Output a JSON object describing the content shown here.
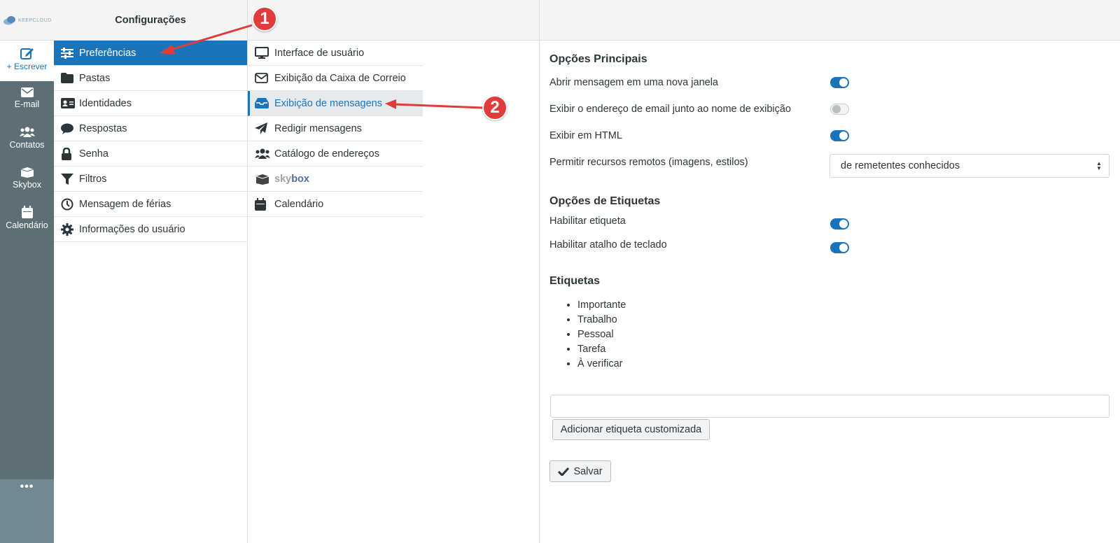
{
  "brand": {
    "logo_text": "KEEPCLOUD"
  },
  "rail": {
    "compose_label": "+ Escrever",
    "items": [
      {
        "label": "E-mail",
        "icon": "envelope-icon"
      },
      {
        "label": "Contatos",
        "icon": "users-icon"
      },
      {
        "label": "Skybox",
        "icon": "box-icon"
      },
      {
        "label": "Calendário",
        "icon": "calendar-icon"
      }
    ],
    "more_label": "•••"
  },
  "menu": {
    "title": "Configurações",
    "items": [
      {
        "label": "Preferências",
        "icon": "sliders-icon",
        "active": true
      },
      {
        "label": "Pastas",
        "icon": "folder-icon"
      },
      {
        "label": "Identidades",
        "icon": "id-card-icon"
      },
      {
        "label": "Respostas",
        "icon": "comment-icon"
      },
      {
        "label": "Senha",
        "icon": "lock-icon"
      },
      {
        "label": "Filtros",
        "icon": "filter-icon"
      },
      {
        "label": "Mensagem de férias",
        "icon": "clock-icon"
      },
      {
        "label": "Informações do usuário",
        "icon": "gear-icon"
      }
    ]
  },
  "sections": {
    "items": [
      {
        "label": "Interface de usuário",
        "icon": "monitor-icon"
      },
      {
        "label": "Exibição da Caixa de Correio",
        "icon": "envelope-outline-icon"
      },
      {
        "label": "Exibição de mensagens",
        "icon": "inbox-icon",
        "active": true
      },
      {
        "label": "Redigir mensagens",
        "icon": "paper-plane-icon"
      },
      {
        "label": "Catálogo de endereços",
        "icon": "users-icon"
      },
      {
        "label_part1": "sky",
        "label_part2": "box",
        "icon": "box-icon"
      },
      {
        "label": "Calendário",
        "icon": "calendar-icon"
      }
    ]
  },
  "content": {
    "main_options_title": "Opções Principais",
    "options": [
      {
        "label": "Abrir mensagem em uma nova janela",
        "enabled": true
      },
      {
        "label": "Exibir o endereço de email junto ao nome de exibição",
        "enabled": false
      },
      {
        "label": "Exibir em HTML",
        "enabled": true
      },
      {
        "label": "Permitir recursos remotos (imagens, estilos)",
        "select_value": "de remetentes conhecidos"
      }
    ],
    "tag_options_title": "Opções de Etiquetas",
    "tag_options": [
      {
        "label": "Habilitar etiqueta",
        "enabled": true
      },
      {
        "label": "Habilitar atalho de teclado",
        "enabled": true
      }
    ],
    "tags_title": "Etiquetas",
    "tags": [
      "Importante",
      "Trabalho",
      "Pessoal",
      "Tarefa",
      "À verificar"
    ],
    "tag_input_value": "",
    "add_tag_button": "Adicionar etiqueta customizada",
    "save_button": "Salvar"
  },
  "annotations": {
    "marker1": "1",
    "marker2": "2"
  },
  "colors": {
    "accent": "#1b74ba",
    "rail": "#5d6f75",
    "marker": "#e03c3c"
  }
}
